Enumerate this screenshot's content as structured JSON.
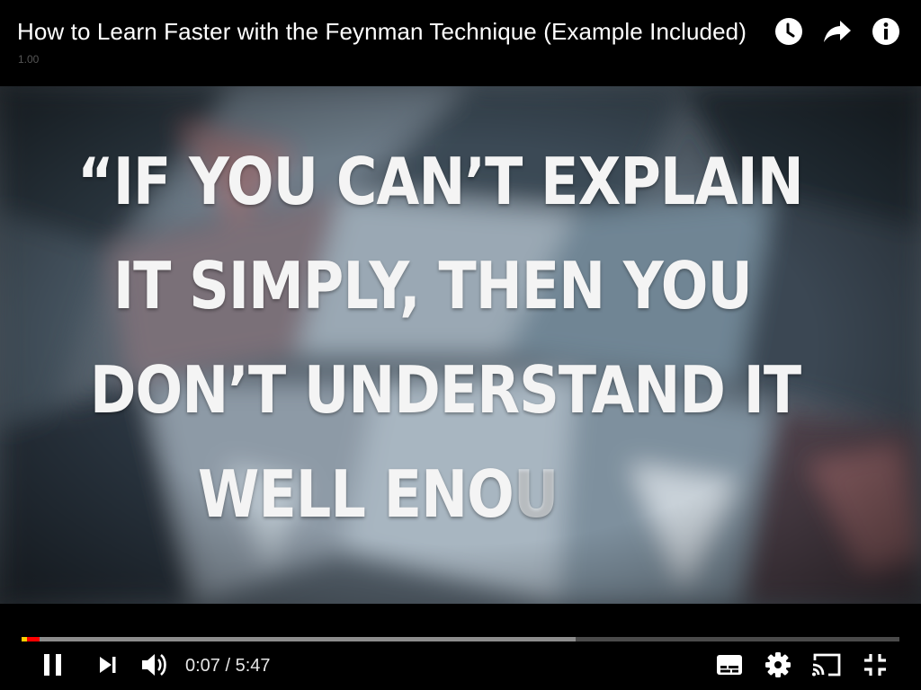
{
  "header": {
    "title": "How to Learn Faster with the Feynman Technique (Example Included)",
    "speed": "1.00",
    "icons": [
      "watch-later-icon",
      "share-icon",
      "info-icon"
    ]
  },
  "video": {
    "quote_lines": [
      "“IF YOU CAN’T EXPLAIN",
      "IT SIMPLY, THEN YOU",
      "DON’T UNDERSTAND IT",
      "WELL ENO"
    ],
    "quote_fading_char": "U"
  },
  "controls": {
    "time_display": "0:07 / 5:47",
    "progress": {
      "played_fraction": 0.021,
      "buffered_fraction": 0.631
    },
    "left_icons": [
      "pause-icon",
      "next-icon",
      "volume-icon"
    ],
    "right_icons": [
      "captions-icon",
      "settings-icon",
      "cast-icon",
      "exit-fullscreen-icon"
    ]
  },
  "colors": {
    "progress_played": "#ff0000",
    "progress_buffered": "#8c8c8c",
    "progress_track": "#4a4a4a",
    "background": "#000000",
    "text": "#ffffff"
  }
}
